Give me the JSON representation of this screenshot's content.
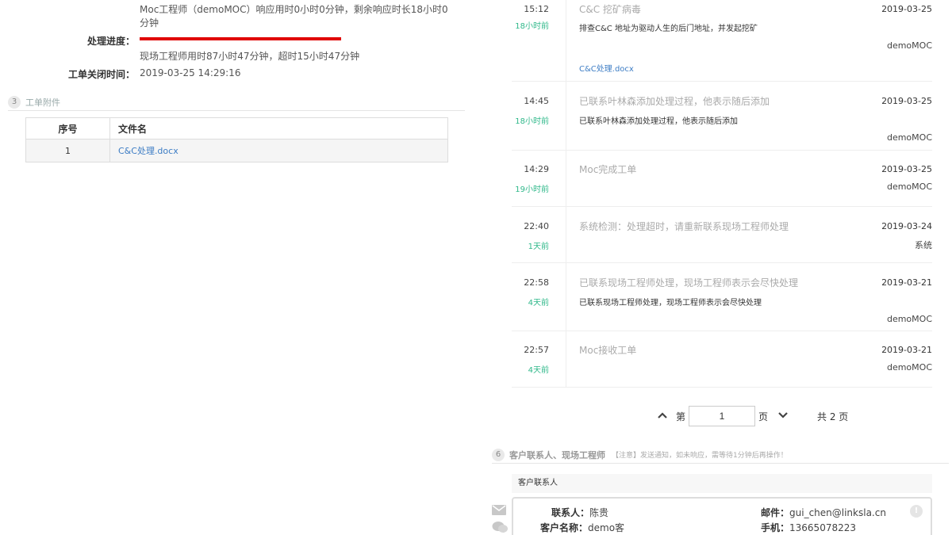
{
  "detail": {
    "response_text": "Moc工程师（demoMOC）响应用时0小时0分钟，剩余响应时长18小时0分钟",
    "progress_label": "处理进度：",
    "time_text": "现场工程师用时87小时47分钟，超时15小时47分钟",
    "close_label": "工单关闭时间：",
    "close_value": "2019-03-25 14:29:16"
  },
  "attachments": {
    "section_num": "3",
    "section_title": "工单附件",
    "col_index": "序号",
    "col_filename": "文件名",
    "rows": [
      {
        "index": "1",
        "filename": "C&C处理.docx"
      }
    ]
  },
  "timeline": [
    {
      "time": "15:12",
      "ago": "18小时前",
      "title": "C&C 挖矿病毒",
      "desc": "排查C&C 地址为驱动人生的后门地址，并发起挖矿",
      "file": "C&C处理.docx",
      "date": "2019-03-25",
      "user": "demoMOC"
    },
    {
      "time": "14:45",
      "ago": "18小时前",
      "title": "已联系叶林森添加处理过程，他表示随后添加",
      "desc": "已联系叶林森添加处理过程，他表示随后添加",
      "date": "2019-03-25",
      "user": "demoMOC"
    },
    {
      "time": "14:29",
      "ago": "19小时前",
      "title": "Moc完成工单",
      "date": "2019-03-25",
      "user": "demoMOC"
    },
    {
      "time": "22:40",
      "ago": "1天前",
      "title": "系统检测：处理超时，请重新联系现场工程师处理",
      "date": "2019-03-24",
      "user": "系统"
    },
    {
      "time": "22:58",
      "ago": "4天前",
      "title": "已联系现场工程师处理，现场工程师表示会尽快处理",
      "desc": "已联系现场工程师处理，现场工程师表示会尽快处理",
      "date": "2019-03-21",
      "user": "demoMOC"
    },
    {
      "time": "22:57",
      "ago": "4天前",
      "title": "Moc接收工单",
      "date": "2019-03-21",
      "user": "demoMOC"
    }
  ],
  "pager": {
    "prefix": "第",
    "page_value": "1",
    "suffix": "页",
    "total": "共 2 页"
  },
  "contacts": {
    "section_num": "6",
    "section_title": "客户联系人、现场工程师",
    "note": "【注意】发送通知，如未响应，需等待1分钟后再操作！",
    "sub_header": "客户联系人",
    "contact_label": "联系人：",
    "contact_value": "陈贵",
    "customer_label": "客户名称：",
    "customer_value": "demo客户",
    "email_label": "邮件：",
    "email_value": "gui_chen@linksla.cn",
    "phone_label": "手机：",
    "phone_value": "13665078223"
  },
  "colors": {
    "progress": "#e00000",
    "link": "#3c7cc4",
    "ago": "#2fb88a"
  },
  "icons": [
    "mail-icon",
    "wechat-icon",
    "info-icon",
    "chevron-up-icon",
    "chevron-down-icon"
  ]
}
